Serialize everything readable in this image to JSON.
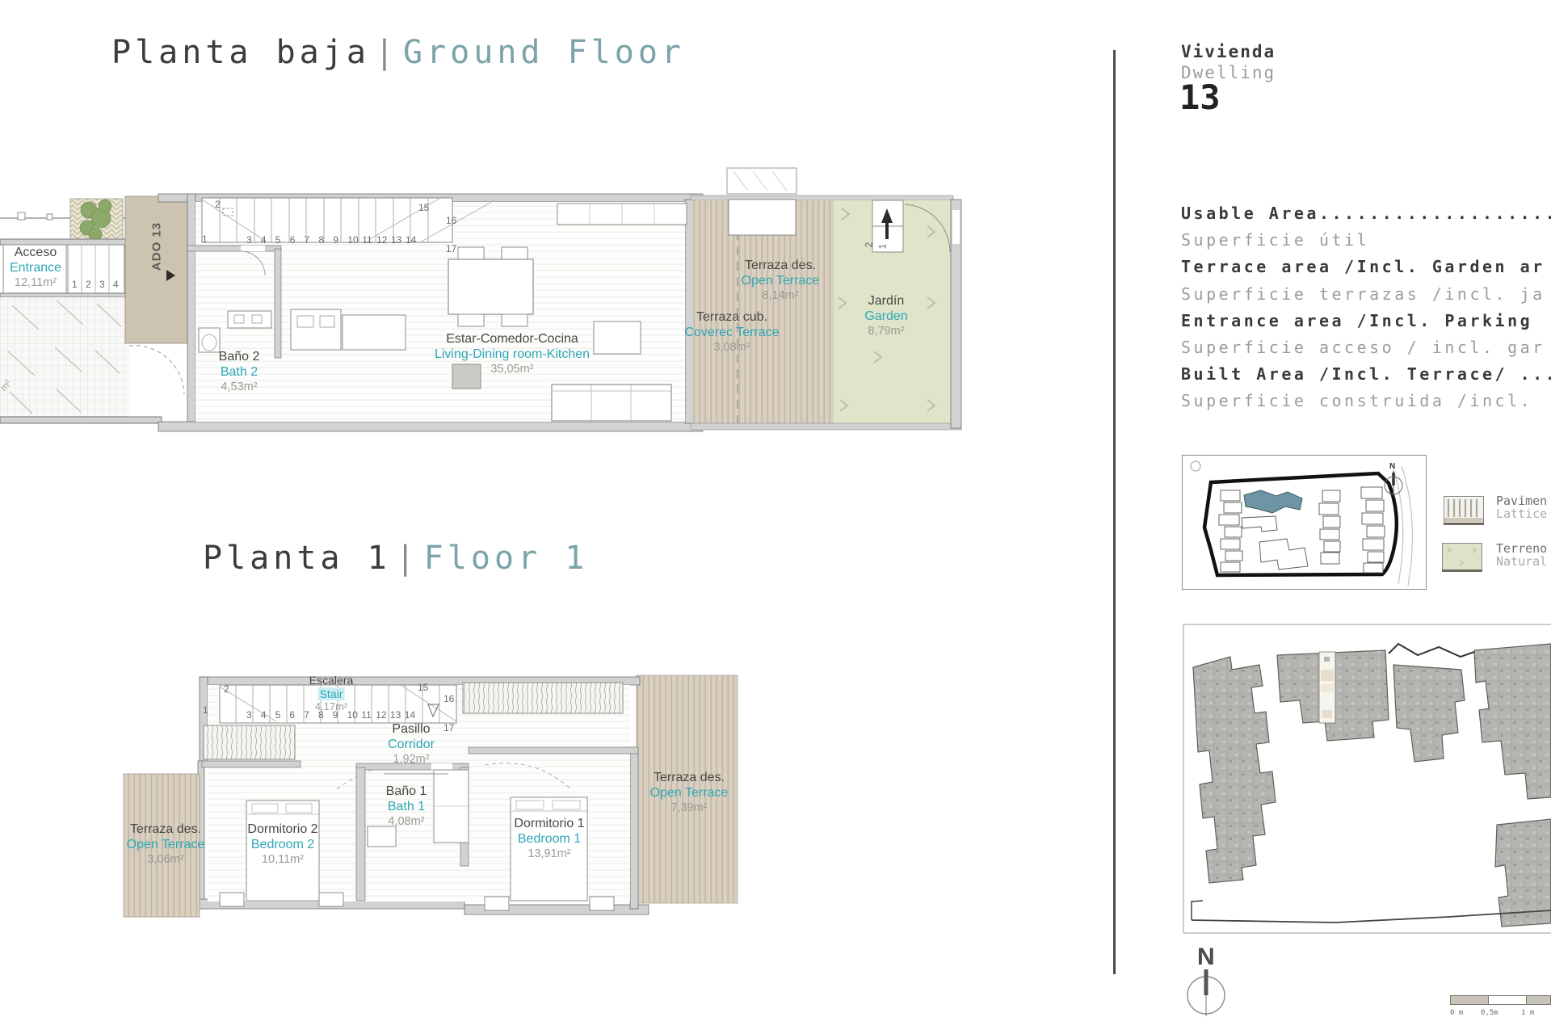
{
  "titles": {
    "ground": {
      "es": "Planta baja",
      "sep": "|",
      "en": "Ground Floor"
    },
    "floor1": {
      "es": "Planta 1",
      "sep": "|",
      "en": "Floor 1"
    }
  },
  "dwelling": {
    "label_es": "Vivienda",
    "label_en": "Dwelling",
    "number": "13"
  },
  "specs": {
    "lines": [
      {
        "style": "b",
        "text": "Usable Area........................."
      },
      {
        "style": "g",
        "text": "Superficie útil"
      },
      {
        "style": "b",
        "text": "Terrace area /Incl. Garden ar"
      },
      {
        "style": "g",
        "text": "Superficie terrazas /incl. ja"
      },
      {
        "style": "b",
        "text": "Entrance area /Incl. Parking "
      },
      {
        "style": "g",
        "text": "Superficie acceso / incl. gar"
      },
      {
        "style": "b",
        "text": "Built Area /Incl. Terrace/ ..."
      },
      {
        "style": "g",
        "text": "Superficie construida /incl. "
      }
    ]
  },
  "ground_floor": {
    "rooms": {
      "acceso": {
        "es": "Acceso",
        "en": "Entrance",
        "area": "12,11m²"
      },
      "bath2": {
        "es": "Baño 2",
        "en": "Bath 2",
        "area": "4,53m²"
      },
      "living": {
        "es": "Estar-Comedor-Cocina",
        "en": "Living-Dining room-Kitchen",
        "area": "35,05m²"
      },
      "terr_open": {
        "es": "Terraza des.",
        "en": "Open Terrace",
        "area": "8,14m²"
      },
      "terr_cov": {
        "es": "Terraza cub.",
        "en": "Coverec Terrace",
        "area": "3,08m²"
      },
      "garden": {
        "es": "Jardín",
        "en": "Garden",
        "area": "8,79m²"
      }
    },
    "ado_label": "ADO 13",
    "stair_run": [
      "3",
      "4",
      "5",
      "6",
      "7",
      "8",
      "9",
      "10",
      "11",
      "12",
      "13",
      "14"
    ],
    "stair_other": {
      "n1": "1",
      "n2": "2",
      "n15": "15",
      "n16": "16",
      "n17": "17"
    },
    "entrance_steps": [
      "1",
      "2",
      "3",
      "4"
    ],
    "garden_steps": {
      "s2": "2",
      "s1": "1"
    },
    "edge_fragment": "m²"
  },
  "floor1": {
    "rooms": {
      "stair": {
        "es": "Escalera",
        "en": "Stair",
        "area": "4,17m²"
      },
      "corridor": {
        "es": "Pasillo",
        "en": "Corridor",
        "area": "1,92m²"
      },
      "bath1": {
        "es": "Baño 1",
        "en": "Bath 1",
        "area": "4,08m²"
      },
      "bedroom2": {
        "es": "Dormitorio 2",
        "en": "Bedroom 2",
        "area": "10,11m²"
      },
      "bedroom1": {
        "es": "Dormitorio 1",
        "en": "Bedroom 1",
        "area": "13,91m²"
      },
      "terr_left": {
        "es": "Terraza des.",
        "en": "Open Terrace",
        "area": "3,06m²"
      },
      "terr_right": {
        "es": "Terraza des.",
        "en": "Open Terrace",
        "area": "7,39m²"
      }
    },
    "stair_run": [
      "3",
      "4",
      "5",
      "6",
      "7",
      "8",
      "9",
      "10",
      "11",
      "12",
      "13",
      "14"
    ],
    "stair_other": {
      "n1": "1",
      "n2": "2",
      "n15": "15",
      "n16": "16",
      "n17": "17"
    }
  },
  "legend": {
    "item1": {
      "line1": "Pavimen",
      "line2": "Lattice"
    },
    "item2": {
      "line1": "Terreno",
      "line2": "Natural"
    }
  },
  "minimap": {
    "compass": "N"
  },
  "sitemap": {
    "compass": "N"
  },
  "scalebar": {
    "l0": "0 m",
    "l05": "0,5m",
    "l1": "1 m"
  },
  "colors": {
    "accent_teal": "#2fa7b8",
    "title_teal": "#7ba3a8",
    "terrace_beige": "#d9d0c1",
    "garden_green": "#e0e5ca",
    "wall_gray": "#d2d2d2",
    "highlight_building": "#6d95a3"
  }
}
